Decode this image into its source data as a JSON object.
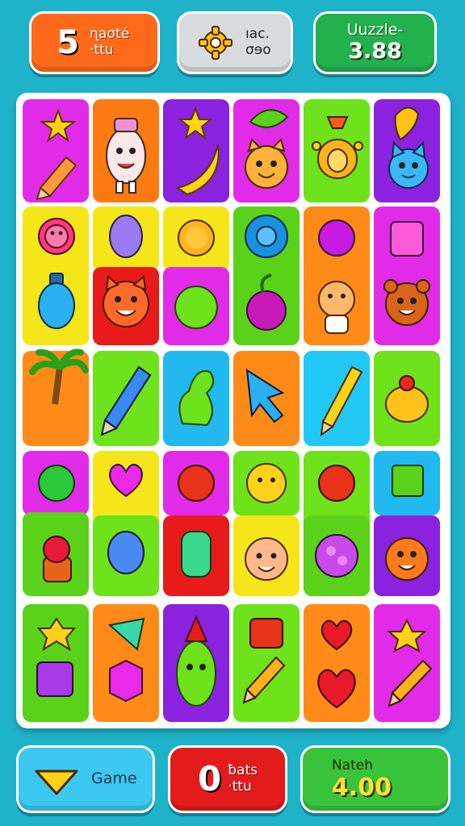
{
  "hud": {
    "left": {
      "big": "5",
      "line1": "ɳaσté",
      "line2": "·ttu"
    },
    "middle": {
      "line1": "ıac.",
      "line2": "σɘo"
    },
    "right": {
      "title": "Uuzzle-",
      "score": "3.88"
    }
  },
  "buttons": {
    "game": {
      "label": "Game"
    },
    "mid": {
      "big": "0",
      "line1": "ƀats",
      "line2": "·ttu"
    },
    "match": {
      "label": "Nateh",
      "score": "4.00"
    }
  },
  "board": {
    "rows": [
      [
        "star-pencil",
        "robot-character",
        "star-banana",
        "leaf-cat-face",
        "orange-lamp",
        "blue-creature"
      ],
      [
        "sun-bottle",
        "balloon",
        "sun-apple",
        "gear-radish",
        "bug-cat",
        "mug-bear"
      ],
      [
        "palm-tree",
        "crayon",
        "green-dino",
        "cursor-arrow",
        "pencil",
        "orange-fruit"
      ],
      [
        "sun-bunny",
        "heart-balloon",
        "sun-jar",
        "bear-face",
        "apple-candy",
        "box-pumpkin"
      ],
      [
        "star-bag",
        "gem-cube",
        "rocket-creature",
        "gift-pencil",
        "heart-heart",
        "star-pencil"
      ]
    ]
  }
}
